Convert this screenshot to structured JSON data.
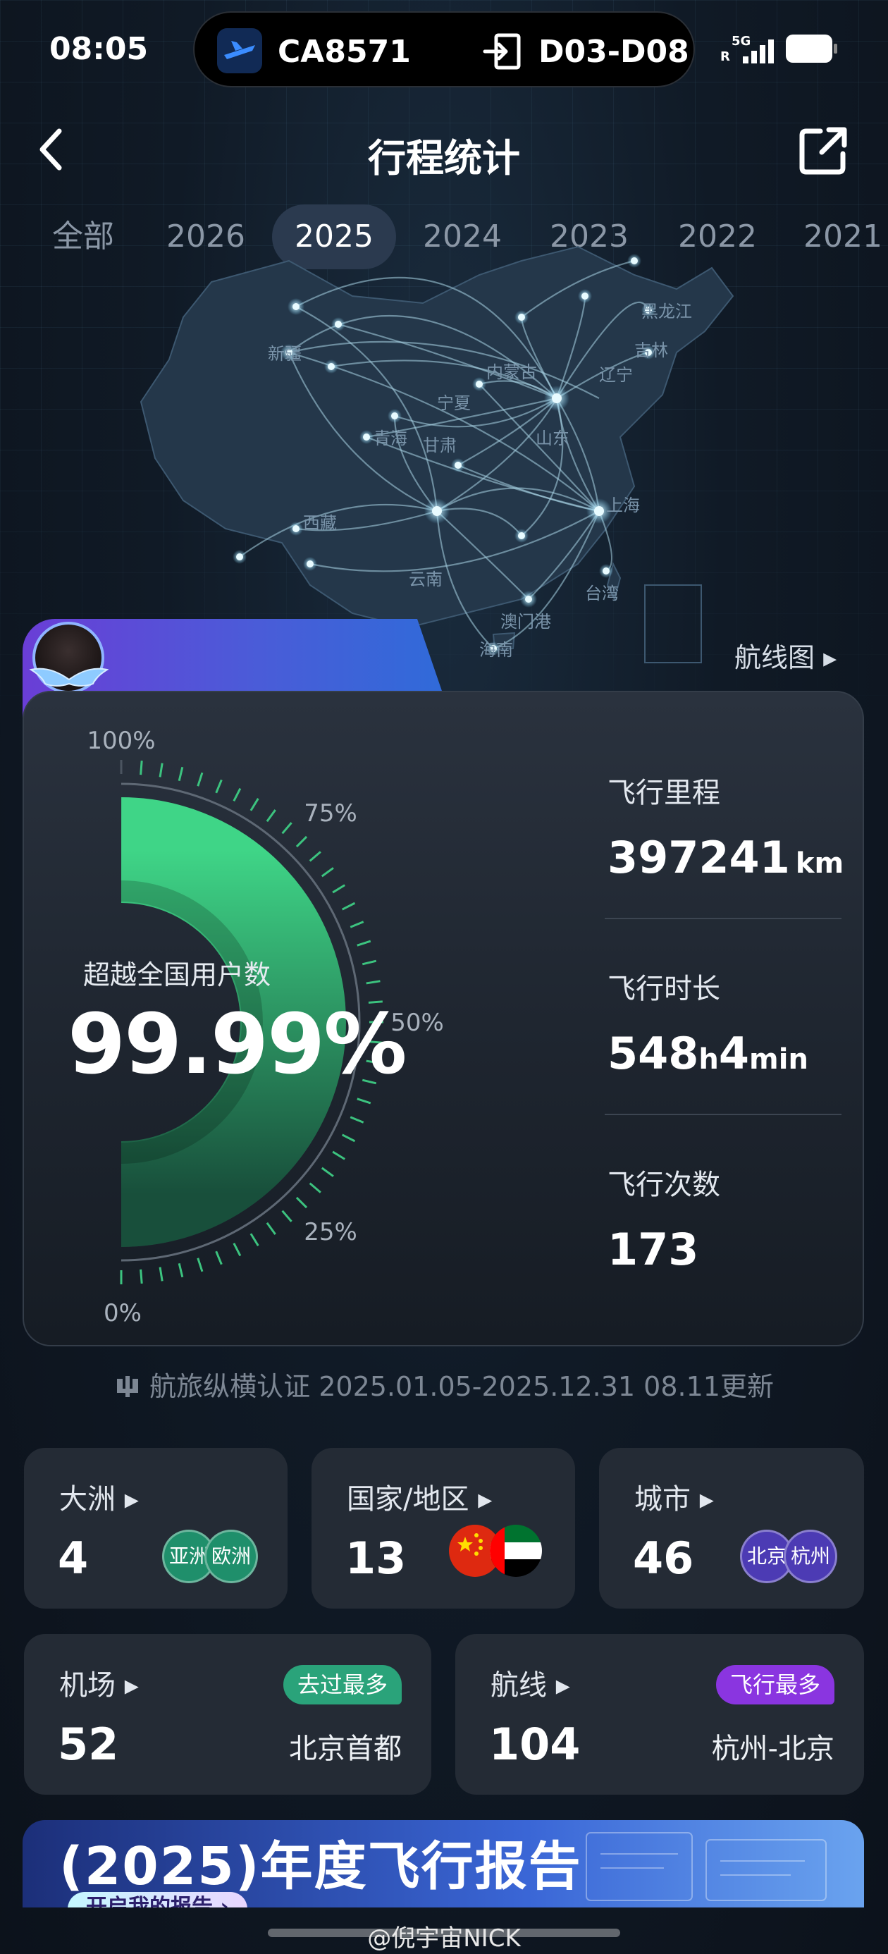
{
  "status_bar": {
    "time": "08:05",
    "flight_number": "CA8571",
    "gate": "D03-D08",
    "network_top": "5G",
    "network_bottom": "R"
  },
  "header": {
    "title": "行程统计"
  },
  "year_tabs": [
    {
      "label": "全部",
      "active": false
    },
    {
      "label": "2026",
      "active": false
    },
    {
      "label": "2025",
      "active": true
    },
    {
      "label": "2024",
      "active": false
    },
    {
      "label": "2023",
      "active": false
    },
    {
      "label": "2022",
      "active": false
    },
    {
      "label": "2021",
      "active": false
    }
  ],
  "map": {
    "link_label": "航线图 ▸",
    "region_labels": [
      "黑龙江",
      "吉林",
      "新疆",
      "内蒙古",
      "辽宁",
      "青海",
      "甘肃",
      "西藏",
      "云南",
      "海南",
      "澳门港",
      "台湾",
      "上海",
      "宁夏",
      "山东"
    ]
  },
  "gauge": {
    "caption": "超越全国用户数",
    "value_text": "99.99%",
    "percentile": 0.9999,
    "tick_labels": [
      "100%",
      "75%",
      "50%",
      "25%",
      "0%"
    ]
  },
  "stats": {
    "distance_label": "飞行里程",
    "distance_value": "397241",
    "distance_unit": "km",
    "duration_label": "飞行时长",
    "duration_hours": "548",
    "duration_hours_unit": "h",
    "duration_minutes": "4",
    "duration_minutes_unit": "min",
    "flights_label": "飞行次数",
    "flights_value": "173"
  },
  "certify_text": "航旅纵横认证 2025.01.05-2025.12.31 08.11更新",
  "cards": {
    "continents": {
      "label": "大洲 ▸",
      "value": "4",
      "chips": [
        "亚洲",
        "欧洲"
      ]
    },
    "countries": {
      "label": "国家/地区 ▸",
      "value": "13",
      "flags": [
        "china-flag",
        "uae-flag"
      ]
    },
    "cities": {
      "label": "城市 ▸",
      "value": "46",
      "chips": [
        "北京",
        "杭州"
      ]
    },
    "airports": {
      "label": "机场 ▸",
      "value": "52",
      "badge": "去过最多",
      "top": "北京首都"
    },
    "routes": {
      "label": "航线 ▸",
      "value": "104",
      "badge": "飞行最多",
      "top": "杭州-北京"
    }
  },
  "report": {
    "title": "(2025)年度飞行报告",
    "button": "开启我的报告 ›"
  },
  "watermark": "@倪宇宙NICK",
  "colors": {
    "accent_green": "#2fbf7c",
    "active_tab": "#2b3a4f",
    "badge_green": "#2aa37a",
    "badge_purple": "#8a35e0"
  }
}
